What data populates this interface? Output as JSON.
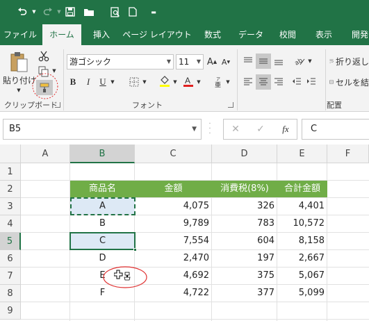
{
  "qat": {
    "undo_icon": "undo-icon",
    "redo_icon": "redo-icon",
    "save_icon": "save-icon",
    "open_icon": "folder-icon",
    "preview_icon": "print-preview-icon",
    "new_icon": "new-document-icon",
    "customize_icon": "customize-qat-icon"
  },
  "tabs": [
    "ファイル",
    "ホーム",
    "挿入",
    "ページ レイアウト",
    "数式",
    "データ",
    "校閲",
    "表示",
    "開発"
  ],
  "active_tab": "ホーム",
  "ribbon": {
    "clipboard": {
      "paste_label": "貼り付け",
      "group_label": "クリップボード"
    },
    "font": {
      "font_name": "游ゴシック",
      "font_size": "11",
      "bold": "B",
      "italic": "I",
      "underline": "U",
      "group_label": "フォント"
    },
    "alignment": {
      "wrap_text_label": "折り返し",
      "merge_label": "セルを結",
      "group_label": "配置"
    }
  },
  "formula_bar": {
    "name_box": "B5",
    "fx_label": "fx",
    "content": "C"
  },
  "grid": {
    "columns": [
      "A",
      "B",
      "C",
      "D",
      "E",
      "F"
    ],
    "rows": [
      "1",
      "2",
      "3",
      "4",
      "5",
      "6",
      "7",
      "8",
      "9"
    ],
    "selected_column": "B",
    "selected_row": "5",
    "table_headers": [
      "商品名",
      "金額",
      "消費税(8%)",
      "合計金額"
    ],
    "table_rows": [
      {
        "product": "A",
        "amount": "4,075",
        "tax": "326",
        "total": "4,401"
      },
      {
        "product": "B",
        "amount": "9,789",
        "tax": "783",
        "total": "10,572"
      },
      {
        "product": "C",
        "amount": "7,554",
        "tax": "604",
        "total": "8,158"
      },
      {
        "product": "D",
        "amount": "2,470",
        "tax": "197",
        "total": "2,667"
      },
      {
        "product": "E",
        "amount": "4,692",
        "tax": "375",
        "total": "5,067"
      },
      {
        "product": "F",
        "amount": "4,722",
        "tax": "377",
        "total": "5,099"
      }
    ]
  },
  "colors": {
    "brand_green": "#217346",
    "table_header_green": "#70ad47",
    "selection_fill": "#dde9f5",
    "annotation_red": "#e03030"
  }
}
